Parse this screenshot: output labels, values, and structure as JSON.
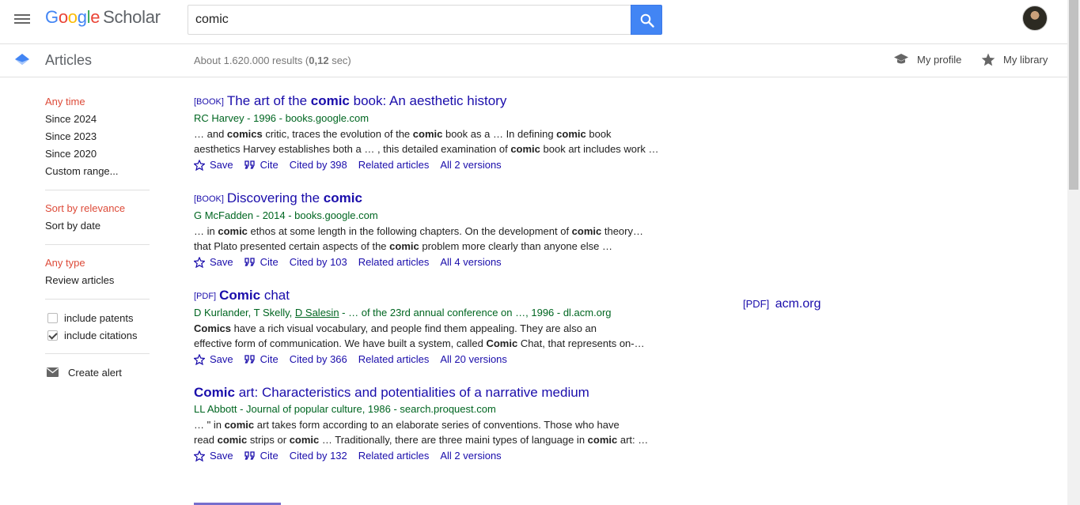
{
  "header": {
    "logo_google": "Google",
    "logo_scholar": "Scholar",
    "search_value": "comic"
  },
  "subheader": {
    "section_label": "Articles",
    "stats_prefix": "About 1.620.000 results (",
    "stats_time": "0,12",
    "stats_suffix": " sec)",
    "my_profile": "My profile",
    "my_library": "My library"
  },
  "sidebar": {
    "time": [
      "Any time",
      "Since 2024",
      "Since 2023",
      "Since 2020",
      "Custom range..."
    ],
    "sort": [
      "Sort by relevance",
      "Sort by date"
    ],
    "type": [
      "Any type",
      "Review articles"
    ],
    "checks": [
      {
        "label": "include patents",
        "checked": false
      },
      {
        "label": "include citations",
        "checked": true
      }
    ],
    "create_alert": "Create alert"
  },
  "results": [
    {
      "tag": "[BOOK]",
      "title_pre": "The art of the ",
      "title_bold": "comic",
      "title_post": " book: An aesthetic history",
      "meta": "RC Harvey - 1996 - books.google.com",
      "snippet_lines": [
        "… and comics critic, traces the evolution of the comic book as a … In defining comic book",
        "aesthetics Harvey establishes both a … , this detailed examination of comic book art includes work …"
      ],
      "cited_by": "Cited by 398",
      "versions": "All 2 versions"
    },
    {
      "tag": "[BOOK]",
      "title_pre": "Discovering the ",
      "title_bold": "comic",
      "title_post": "",
      "meta": "G McFadden - 2014 - books.google.com",
      "snippet_lines": [
        "… in comic ethos at some length in the following chapters. On the development of comic theory…",
        "that Plato presented certain aspects of the comic problem more clearly than anyone else …"
      ],
      "cited_by": "Cited by 103",
      "versions": "All 4 versions"
    },
    {
      "tag": "[PDF]",
      "title_pre": "",
      "title_bold": "Comic",
      "title_post": " chat",
      "meta_pre": "D Kurlander, T Skelly, ",
      "meta_link": "D Salesin",
      "meta_post": " - … of the 23rd annual conference on …, 1996 - dl.acm.org",
      "snippet_lines": [
        "Comics have a rich visual vocabulary, and people find them appealing. They are also an",
        "effective form of communication. We have built a system, called Comic Chat, that represents on-…"
      ],
      "cited_by": "Cited by 366",
      "versions": "All 20 versions",
      "side_tag": "[PDF]",
      "side_source": "acm.org"
    },
    {
      "tag": "",
      "title_pre": "",
      "title_bold": "Comic",
      "title_post": " art: Characteristics and potentialities of a narrative medium",
      "meta": "LL Abbott - Journal of popular culture, 1986 - search.proquest.com",
      "snippet_lines": [
        "… \" in comic art takes form according to an elaborate series of conventions. Those who have",
        "read comic strips or comic … Traditionally, there are three maini types of language in comic art: …"
      ],
      "cited_by": "Cited by 132",
      "versions": "All 2 versions"
    }
  ],
  "actions": {
    "save": "Save",
    "cite": "Cite",
    "related": "Related articles"
  },
  "colors": {
    "link": "#1a0dab",
    "meta_green": "#006621",
    "active_red": "#dd4b39",
    "search_blue": "#4285f4"
  }
}
